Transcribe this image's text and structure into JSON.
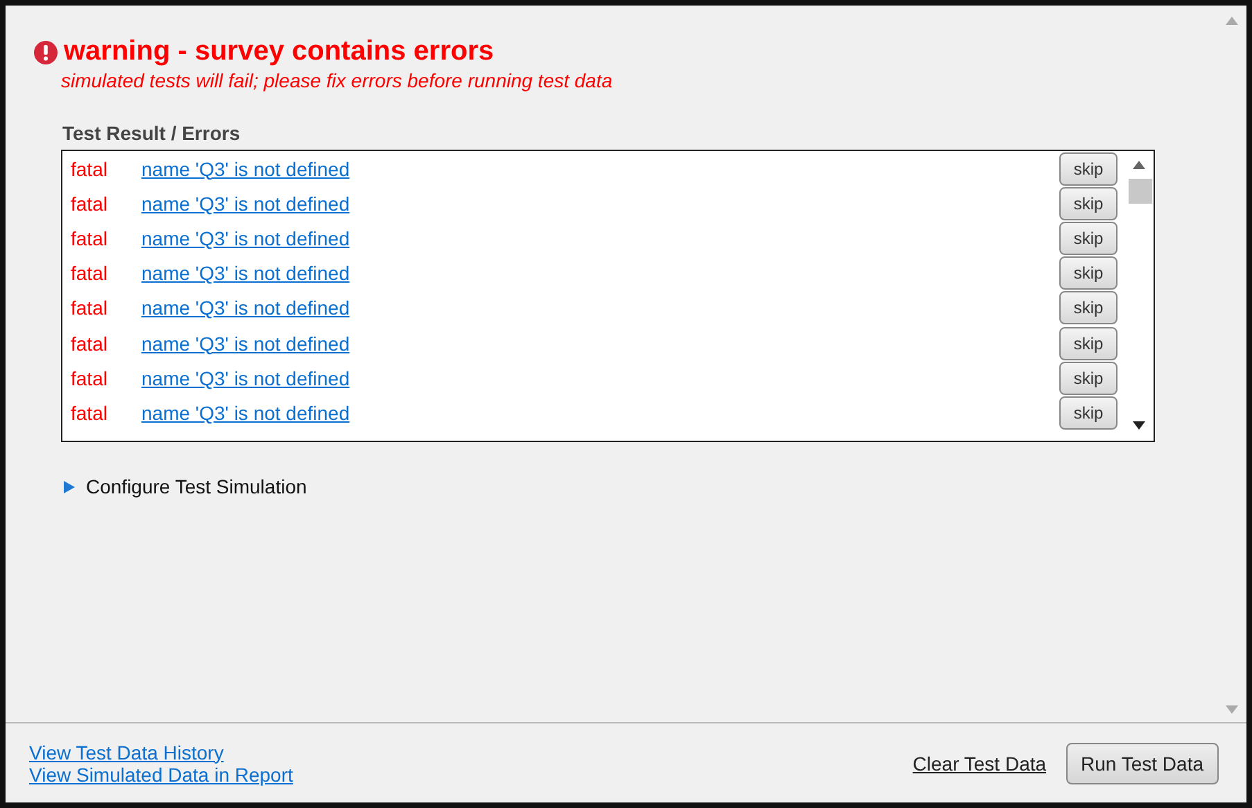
{
  "warning": {
    "title": "warning - survey contains errors",
    "subtitle": "simulated tests will fail; please fix errors before running test data"
  },
  "results": {
    "label": "Test Result / Errors",
    "rows": [
      {
        "severity": "fatal",
        "message": "name 'Q3' is not defined",
        "action": "skip"
      },
      {
        "severity": "fatal",
        "message": "name 'Q3' is not defined",
        "action": "skip"
      },
      {
        "severity": "fatal",
        "message": "name 'Q3' is not defined",
        "action": "skip"
      },
      {
        "severity": "fatal",
        "message": "name 'Q3' is not defined",
        "action": "skip"
      },
      {
        "severity": "fatal",
        "message": "name 'Q3' is not defined",
        "action": "skip"
      },
      {
        "severity": "fatal",
        "message": "name 'Q3' is not defined",
        "action": "skip"
      },
      {
        "severity": "fatal",
        "message": "name 'Q3' is not defined",
        "action": "skip"
      },
      {
        "severity": "fatal",
        "message": "name 'Q3' is not defined",
        "action": "skip"
      }
    ]
  },
  "configure": {
    "label": "Configure Test Simulation",
    "expanded": false
  },
  "footer": {
    "links": [
      "View Test Data History",
      "View Simulated Data in Report"
    ],
    "clear": "Clear Test Data",
    "run": "Run Test Data"
  }
}
